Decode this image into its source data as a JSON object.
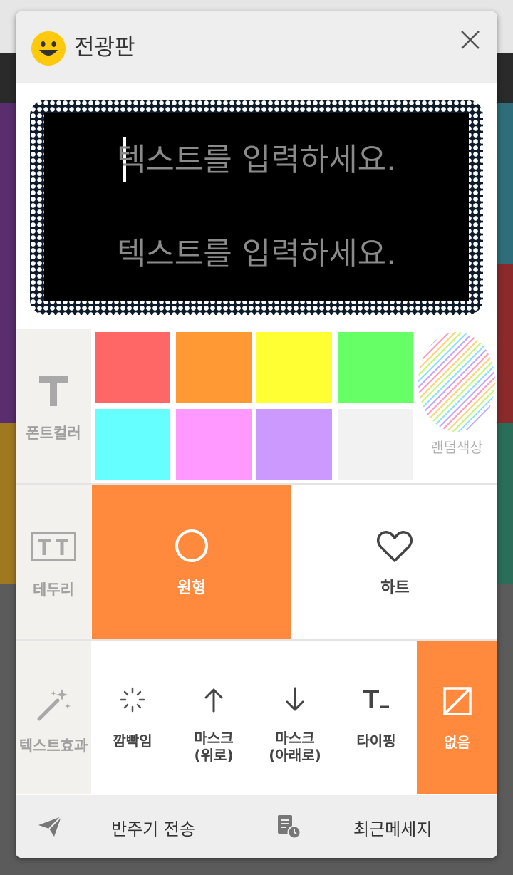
{
  "dialog": {
    "title": "전광판",
    "icons": {
      "logo": "smiley-icon",
      "close": "close-icon"
    }
  },
  "board": {
    "line1": "텍스트를 입력하세요.",
    "line2": "텍스트를 입력하세요."
  },
  "font_color": {
    "label": "폰트컬러",
    "swatches": [
      "#ff6666",
      "#ff9933",
      "#ffff33",
      "#66ff66",
      "#66ffff",
      "#ff99ff",
      "#cc99ff",
      "#f2f2f2"
    ],
    "random_label": "랜덤색상"
  },
  "border": {
    "label": "테두리",
    "options": [
      {
        "label": "원형",
        "icon": "circle-icon",
        "selected": true
      },
      {
        "label": "하트",
        "icon": "heart-icon",
        "selected": false
      }
    ]
  },
  "effect": {
    "label": "텍스트효과",
    "options": [
      {
        "label": "깜빡임",
        "icon": "sparkle-icon",
        "selected": false
      },
      {
        "label": "마스크\n(위로)",
        "icon": "arrow-up-icon",
        "selected": false
      },
      {
        "label": "마스크\n(아래로)",
        "icon": "arrow-down-icon",
        "selected": false
      },
      {
        "label": "타이핑",
        "icon": "typing-icon",
        "selected": false
      },
      {
        "label": "없음",
        "icon": "none-icon",
        "selected": true
      }
    ]
  },
  "footer": {
    "send_label": "반주기 전송",
    "recent_label": "최근메세지"
  },
  "colors": {
    "accent": "#ff8a3d",
    "header_bg": "#eeeeee",
    "label_bg": "#f2f1ed"
  }
}
